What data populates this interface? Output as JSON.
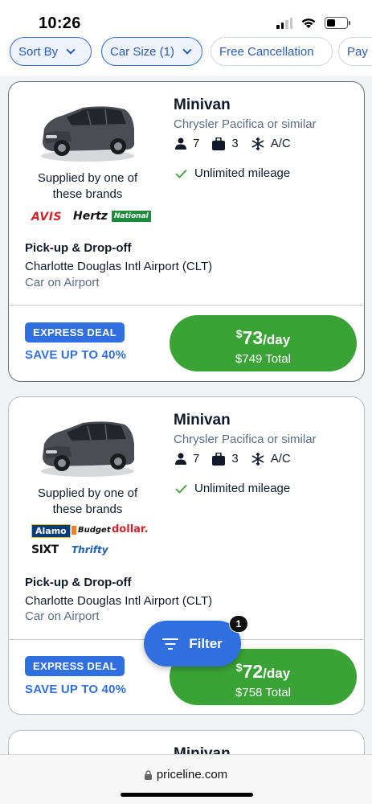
{
  "status": {
    "time": "10:26"
  },
  "chips": [
    {
      "label": "Sort By"
    },
    {
      "label": "Car Size (1)"
    },
    {
      "label": "Free Cancellation"
    },
    {
      "label": "Pay"
    }
  ],
  "cards": [
    {
      "name": "Minivan",
      "similar": "Chrysler Pacifica or similar",
      "passengers": "7",
      "bags": "3",
      "ac": "A/C",
      "mileage": "Unlimited mileage",
      "supplied": "Supplied by one of these brands",
      "brands": [
        "AVIS",
        "Hertz",
        "National"
      ],
      "pickup_title": "Pick-up & Drop-off",
      "pickup_location": "Charlotte Douglas Intl Airport (CLT)",
      "pickup_type": "Car on Airport",
      "deal_badge": "EXPRESS DEAL",
      "save_text": "SAVE UP TO 40%",
      "price_currency": "$",
      "price": "73",
      "price_unit": "/day",
      "total": "$749 Total"
    },
    {
      "name": "Minivan",
      "similar": "Chrysler Pacifica or similar",
      "passengers": "7",
      "bags": "3",
      "ac": "A/C",
      "mileage": "Unlimited mileage",
      "supplied": "Supplied by one of these brands",
      "brands": [
        "Alamo",
        "Budget",
        "dollar.",
        "SIXT",
        "Thrifty"
      ],
      "pickup_title": "Pick-up & Drop-off",
      "pickup_location": "Charlotte Douglas Intl Airport (CLT)",
      "pickup_type": "Car on Airport",
      "deal_badge": "EXPRESS DEAL",
      "save_text": "SAVE UP TO 40%",
      "price_currency": "$",
      "price": "72",
      "price_unit": "/day",
      "total": "$758 Total"
    },
    {
      "name": "Minivan"
    }
  ],
  "filter_button": {
    "label": "Filter",
    "badge": "1"
  },
  "browser": {
    "url": "priceline.com"
  },
  "colors": {
    "accent_blue": "#2f6fe0",
    "price_green": "#3aa335"
  }
}
